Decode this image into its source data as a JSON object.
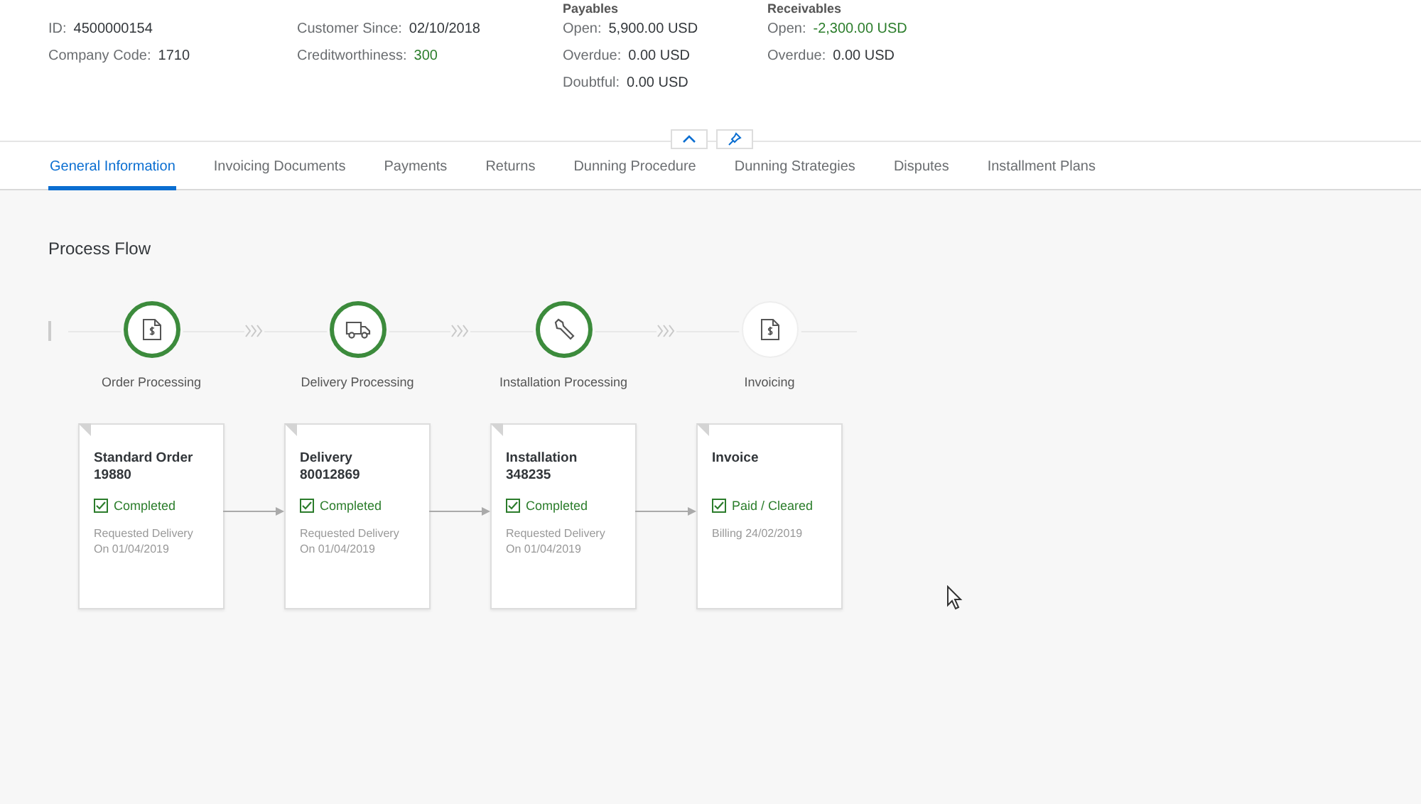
{
  "header": {
    "columns": [
      {
        "fields": [
          {
            "label": "ID:",
            "value": "4500000154",
            "kind": "normal"
          },
          {
            "label": "Company Code:",
            "value": "1710",
            "kind": "normal"
          }
        ]
      },
      {
        "fields": [
          {
            "label": "Customer Since:",
            "value": "02/10/2018",
            "kind": "normal"
          },
          {
            "label": "Creditworthiness:",
            "value": "300",
            "kind": "positive"
          }
        ]
      },
      {
        "heading": "Payables",
        "fields": [
          {
            "label": "Open:",
            "value": "5,900.00 USD",
            "kind": "normal"
          },
          {
            "label": "Overdue:",
            "value": "0.00 USD",
            "kind": "normal"
          },
          {
            "label": "Doubtful:",
            "value": "0.00 USD",
            "kind": "normal"
          }
        ]
      },
      {
        "heading": "Receivables",
        "fields": [
          {
            "label": "Open:",
            "value": "-2,300.00 USD",
            "kind": "positive"
          },
          {
            "label": "Overdue:",
            "value": "0.00 USD",
            "kind": "normal"
          }
        ]
      }
    ]
  },
  "tabs": [
    {
      "label": "General Information",
      "selected": true
    },
    {
      "label": "Invoicing Documents",
      "selected": false
    },
    {
      "label": "Payments",
      "selected": false
    },
    {
      "label": "Returns",
      "selected": false
    },
    {
      "label": "Dunning Procedure",
      "selected": false
    },
    {
      "label": "Dunning Strategies",
      "selected": false
    },
    {
      "label": "Disputes",
      "selected": false
    },
    {
      "label": "Installment Plans",
      "selected": false
    }
  ],
  "process_flow": {
    "title": "Process Flow",
    "steps": [
      {
        "label": "Order Processing",
        "kind": "document",
        "completed": true
      },
      {
        "label": "Delivery Processing",
        "kind": "truck",
        "completed": true
      },
      {
        "label": "Installation Processing",
        "kind": "wrench",
        "completed": true
      },
      {
        "label": "Invoicing",
        "kind": "document",
        "completed": false
      }
    ],
    "cards": [
      {
        "title": "Standard Order",
        "number": "19880",
        "status": "Completed",
        "details": [
          "Requested Delivery",
          "On 01/04/2019"
        ]
      },
      {
        "title": "Delivery",
        "number": "80012869",
        "status": "Completed",
        "details": [
          "Requested Delivery",
          "On 01/04/2019"
        ]
      },
      {
        "title": "Installation",
        "number": "348235",
        "status": "Completed",
        "details": [
          "Requested Delivery",
          "On 01/04/2019"
        ]
      },
      {
        "title": "Invoice",
        "status": "Paid / Cleared",
        "details": [
          "Billing 24/02/2019"
        ]
      }
    ]
  }
}
